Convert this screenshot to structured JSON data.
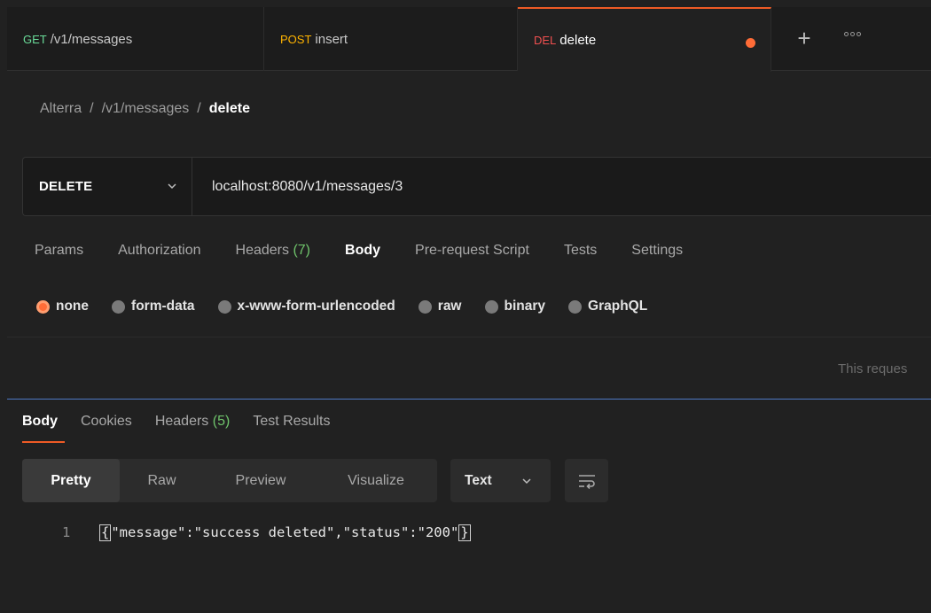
{
  "tabs": [
    {
      "method": "GET",
      "name": "/v1/messages",
      "method_color": "#6bdd9a"
    },
    {
      "method": "POST",
      "name": "insert",
      "method_color": "#ffb400"
    },
    {
      "method": "DEL",
      "name": "delete",
      "method_color": "#f05050"
    }
  ],
  "breadcrumb": {
    "workspace": "Alterra",
    "sep1": "/",
    "folder": "/v1/messages",
    "sep2": "/",
    "current": "delete"
  },
  "request": {
    "method": "DELETE",
    "url": "localhost:8080/v1/messages/3"
  },
  "request_tabs": {
    "params": "Params",
    "authorization": "Authorization",
    "headers": "Headers",
    "headers_count": "(7)",
    "body": "Body",
    "prerequest": "Pre-request Script",
    "tests": "Tests",
    "settings": "Settings"
  },
  "body_types": {
    "none": "none",
    "form_data": "form-data",
    "urlencoded": "x-www-form-urlencoded",
    "raw": "raw",
    "binary": "binary",
    "graphql": "GraphQL",
    "selected": "none"
  },
  "notice": "This reques",
  "response_tabs": {
    "body": "Body",
    "cookies": "Cookies",
    "headers": "Headers",
    "headers_count": "(5)",
    "test_results": "Test Results"
  },
  "view_modes": {
    "pretty": "Pretty",
    "raw": "Raw",
    "preview": "Preview",
    "visualize": "Visualize",
    "selected": "Pretty"
  },
  "format": {
    "selected": "Text"
  },
  "response_code": {
    "line_number": "1",
    "content": "\"message\":\"success deleted\",\"status\":\"200\"",
    "open": "{",
    "close": "}"
  },
  "colors": {
    "accent": "#ff6c37",
    "green": "#6fc36b",
    "divider": "#4e79c4"
  }
}
